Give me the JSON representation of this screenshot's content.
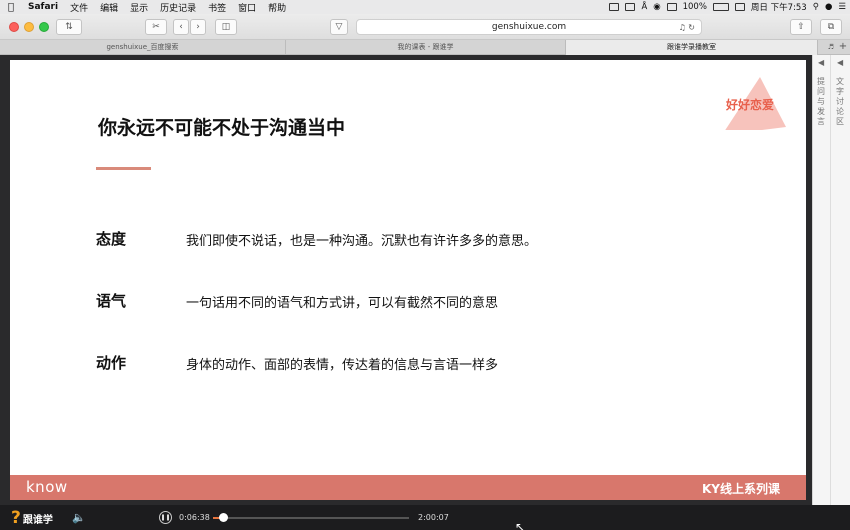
{
  "menubar": {
    "apple_icon": "apple-icon",
    "items": [
      "Safari",
      "文件",
      "编辑",
      "显示",
      "历史记录",
      "书签",
      "窗口",
      "帮助"
    ],
    "battery": "100%",
    "clock": "周日 下午7:53"
  },
  "browser": {
    "url": "genshuixue.com",
    "tabs": [
      {
        "label": "genshuixue_百度搜索",
        "active": false
      },
      {
        "label": "我的课表 - 跟谁学",
        "active": false
      },
      {
        "label": "跟谁学录播教室",
        "active": true
      }
    ]
  },
  "slide": {
    "title": "你永远不可能不处于沟通当中",
    "rows": [
      {
        "label": "态度",
        "text": "我们即使不说话，也是一种沟通。沉默也有许许多多的意思。"
      },
      {
        "label": "语气",
        "text": "一句话用不同的语气和方式讲，可以有截然不同的意思"
      },
      {
        "label": "动作",
        "text": "身体的动作、面部的表情，传达着的信息与言语一样多"
      }
    ],
    "logo_text": "好好恋爱",
    "footer_left": "know",
    "footer_right": "KY线上系列课",
    "accent": "#d8776c"
  },
  "side_panel": {
    "col1": "提问与发言",
    "col2": "文字讨论区"
  },
  "player": {
    "brand": "跟谁学",
    "current_time": "0:06:38",
    "total_time": "2:00:07",
    "progress": 0.055
  }
}
